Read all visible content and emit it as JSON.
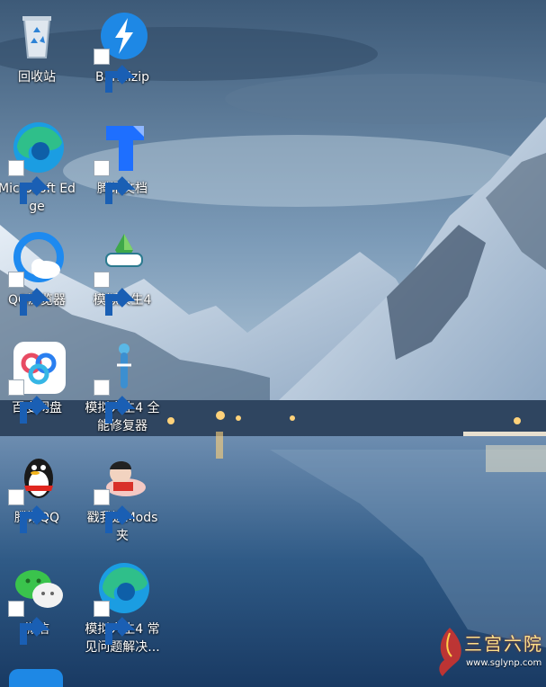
{
  "desktop": {
    "icons": [
      {
        "label": "回收站",
        "icon": "recycle-bin-icon",
        "shortcut": false
      },
      {
        "label": "Bandizip",
        "icon": "bandizip-icon",
        "shortcut": true
      },
      {
        "label": "Microsoft Edge",
        "icon": "edge-icon",
        "shortcut": true
      },
      {
        "label": "腾讯文档",
        "icon": "tencent-docs-icon",
        "shortcut": true
      },
      {
        "label": "QQ浏览器",
        "icon": "qq-browser-icon",
        "shortcut": true
      },
      {
        "label": "模拟人生4",
        "icon": "sims4-icon",
        "shortcut": true
      },
      {
        "label": "百度网盘",
        "icon": "baidu-netdisk-icon",
        "shortcut": true
      },
      {
        "label": "模拟人生4 全能修复器",
        "icon": "sims4-repair-icon",
        "shortcut": true
      },
      {
        "label": "腾讯QQ",
        "icon": "qq-icon",
        "shortcut": true
      },
      {
        "label": "戳我进Mods夹",
        "icon": "mods-folder-icon",
        "shortcut": true
      },
      {
        "label": "微信",
        "icon": "wechat-icon",
        "shortcut": true
      },
      {
        "label": "模拟人生4 常见问题解决...",
        "icon": "edge-icon",
        "shortcut": true
      }
    ]
  },
  "watermark": {
    "title": "三宫六院",
    "url": "www.sglynp.com"
  }
}
